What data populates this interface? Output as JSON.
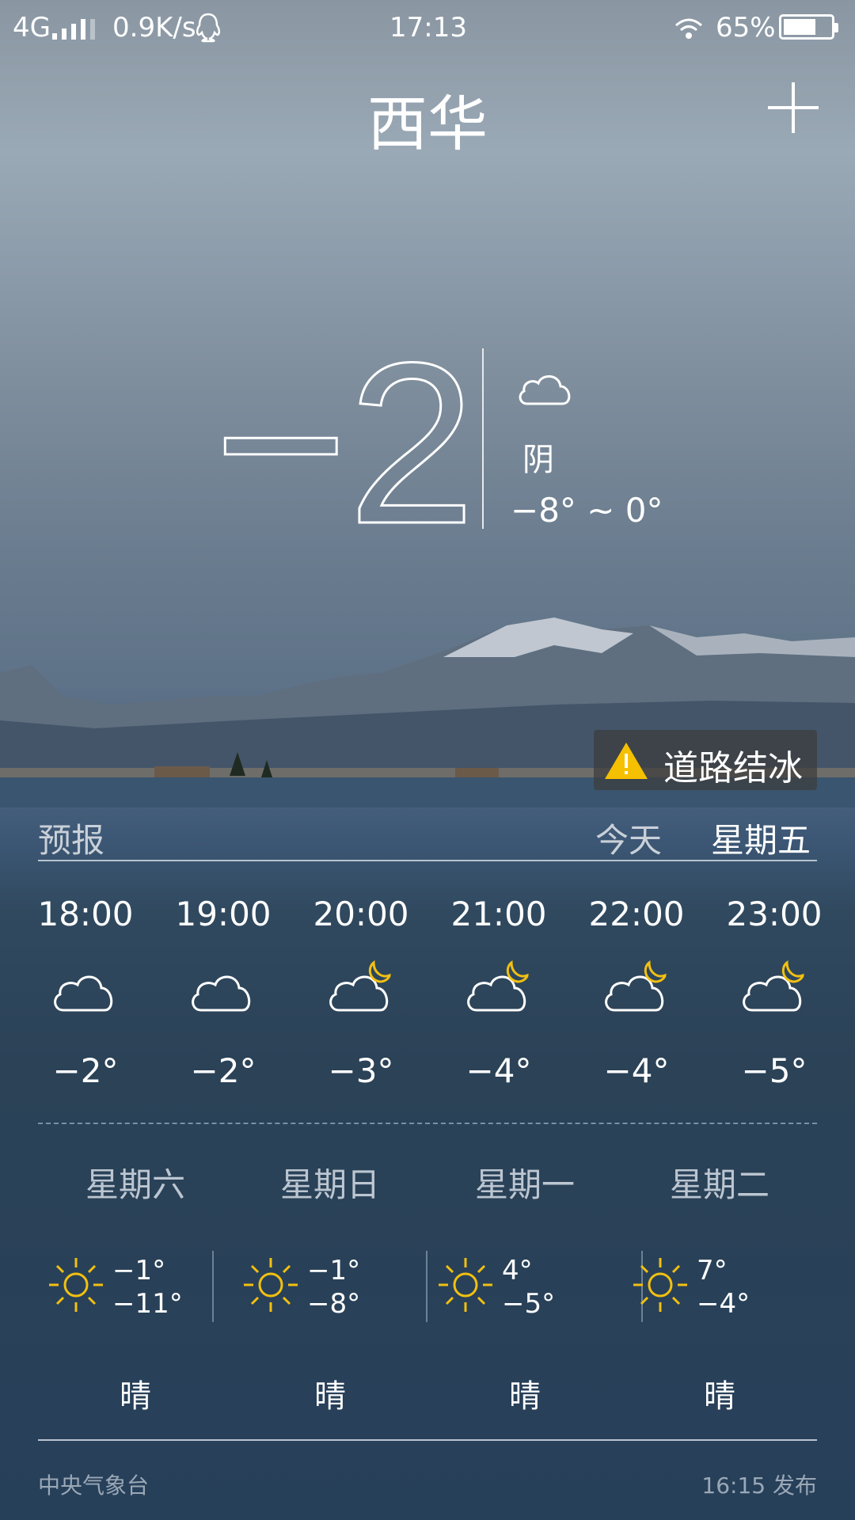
{
  "status_bar": {
    "network": "4G",
    "speed": "0.9K/s",
    "time": "17:13",
    "battery": "65%"
  },
  "city": "西华",
  "current": {
    "temp": "−2°",
    "condition": "阴",
    "range": "−8° ~ 0°",
    "icon": "cloud-icon"
  },
  "alert": {
    "text": "道路结冰",
    "icon": "warning-icon"
  },
  "forecast": {
    "label": "预报",
    "today_label": "今天",
    "weekday_label": "星期五"
  },
  "hourly": [
    {
      "time": "18:00",
      "icon": "cloud-icon",
      "temp": "−2°"
    },
    {
      "time": "19:00",
      "icon": "cloud-icon",
      "temp": "−2°"
    },
    {
      "time": "20:00",
      "icon": "cloud-moon-icon",
      "temp": "−3°"
    },
    {
      "time": "21:00",
      "icon": "cloud-moon-icon",
      "temp": "−4°"
    },
    {
      "time": "22:00",
      "icon": "cloud-moon-icon",
      "temp": "−4°"
    },
    {
      "time": "23:00",
      "icon": "cloud-moon-icon",
      "temp": "−5°"
    }
  ],
  "daily": [
    {
      "day": "星期六",
      "hi": "−1°",
      "lo": "−11°",
      "condition": "晴",
      "icon": "sun-icon"
    },
    {
      "day": "星期日",
      "hi": "−1°",
      "lo": "−8°",
      "condition": "晴",
      "icon": "sun-icon"
    },
    {
      "day": "星期一",
      "hi": "4°",
      "lo": "−5°",
      "condition": "晴",
      "icon": "sun-icon"
    },
    {
      "day": "星期二",
      "hi": "7°",
      "lo": "−4°",
      "condition": "晴",
      "icon": "sun-icon"
    }
  ],
  "footer": {
    "source": "中央气象台",
    "published": "16:15 发布"
  },
  "colors": {
    "sun": "#f2c010",
    "warning": "#f5c000"
  }
}
